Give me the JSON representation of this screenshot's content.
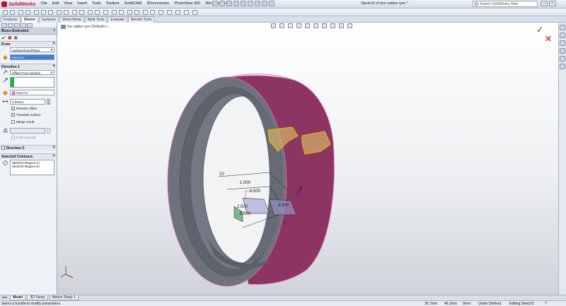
{
  "app": {
    "logo": "SolidWorks",
    "window_title": "Sketch2 of tire rubber tyre *"
  },
  "menu": [
    "File",
    "Edit",
    "View",
    "Insert",
    "Tools",
    "Toolbox",
    "SolidCAM",
    "3Dconnexion",
    "PhotoView 360",
    "Window",
    "Help"
  ],
  "search": {
    "placeholder": "Search SolidWorks Help"
  },
  "window_controls": {
    "minimize": "–",
    "restore": "▫",
    "close": "×"
  },
  "command_tabs": [
    "Features",
    "Sketch",
    "Surfaces",
    "Sheet Metal",
    "Mold Tools",
    "Evaluate",
    "Render Tools"
  ],
  "active_command_tab": "Sketch",
  "breadcrumb": "tire rubber tyre  (Default<<...",
  "property_manager": {
    "title": "Boss-Extrude1",
    "help": "?",
    "from": {
      "header": "From",
      "start_condition": "Surface/Face/Plane",
      "face": "Face<1>"
    },
    "direction1": {
      "header": "Direction 1",
      "end_condition": "Offset From Surface",
      "face": "Face<1>",
      "offset": "2.00mm",
      "reverse_offset": "Reverse offset",
      "translate_surface": "Translate surface",
      "merge_result": "Merge result",
      "draft_outward": "Draft outward"
    },
    "direction2": {
      "header": "Direction 2"
    },
    "selected_contours": {
      "header": "Selected Contours",
      "items": [
        "Sketch2-Region<1>",
        "Sketch2-Region<2>"
      ]
    }
  },
  "sketch_dims": [
    "10",
    "1.000",
    "2.500",
    "2.500",
    "5.500",
    "4.900",
    "7.000",
    "5"
  ],
  "bottom_tabs": [
    "Model",
    "3D Views",
    "Motion Study 1"
  ],
  "status": {
    "message": "Select a handle to modify parameters.",
    "x": "36.7mm",
    "y": "46.2mm",
    "z": "0mm",
    "state": "Under Defined",
    "editing": "Editing Sketch2"
  },
  "colors": {
    "tyre_outer": "#8c3562",
    "tyre_inner": "#6e727c",
    "highlight": "#e6b800",
    "accent": "#c8102e"
  }
}
